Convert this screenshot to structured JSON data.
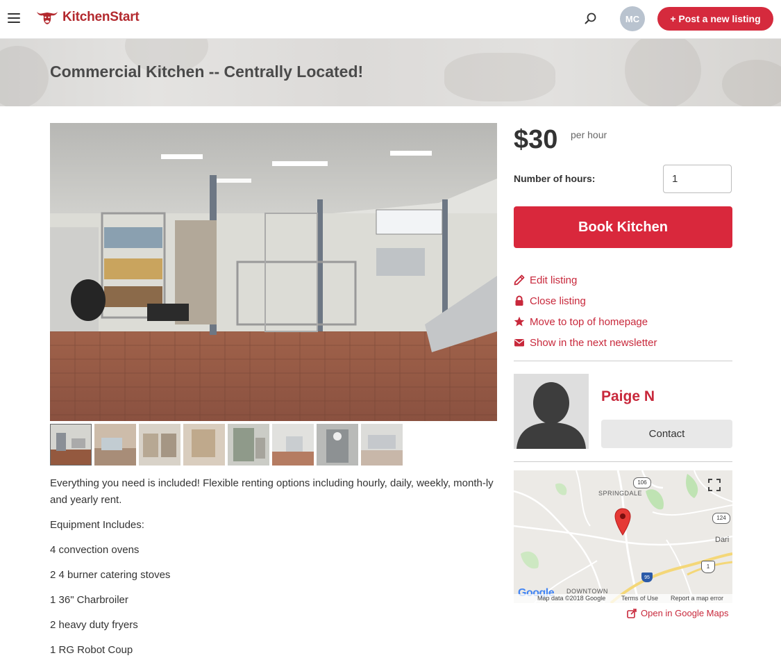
{
  "header": {
    "menu_icon": "hamburger-icon",
    "logo_text": "KitchenStart",
    "logo_icon": "bull-head-icon",
    "search_icon": "search-icon",
    "avatar_initials": "MC",
    "post_button_label": "+ Post a new listing"
  },
  "hero": {
    "title": "Commercial Kitchen -- Centrally Located!"
  },
  "gallery": {
    "thumbnail_count": 8
  },
  "description": {
    "paragraphs": [
      "Everything you need is included! Flexible renting options including hourly, daily, weekly, month-ly and yearly rent.",
      "Equipment Includes:",
      "4 convection ovens",
      "2 4 burner catering stoves",
      "1 36\" Charbroiler",
      "2 heavy duty fryers",
      "1 RG Robot Coup"
    ]
  },
  "booking": {
    "price": "$30",
    "price_unit": "per hour",
    "hours_label": "Number of hours:",
    "hours_value": "1",
    "book_button_label": "Book Kitchen"
  },
  "actions": [
    {
      "label": "Edit listing",
      "icon": "pencil-icon"
    },
    {
      "label": "Close listing",
      "icon": "lock-icon"
    },
    {
      "label": "Move to top of homepage",
      "icon": "star-icon"
    },
    {
      "label": "Show in the next newsletter",
      "icon": "envelope-icon"
    }
  ],
  "owner": {
    "name": "Paige N",
    "contact_label": "Contact"
  },
  "map": {
    "labels": {
      "springdale": "SPRINGDALE",
      "downtown": "DOWNTOWN",
      "darien": "Dari"
    },
    "route_shields": [
      "106",
      "124",
      "1",
      "95"
    ],
    "google_logo": "Google",
    "footer": {
      "data": "Map data ©2018 Google",
      "terms": "Terms of Use",
      "report": "Report a map error"
    },
    "open_label": "Open in Google Maps"
  },
  "colors": {
    "brand_red": "#d9283c",
    "link_red": "#c8283b"
  }
}
